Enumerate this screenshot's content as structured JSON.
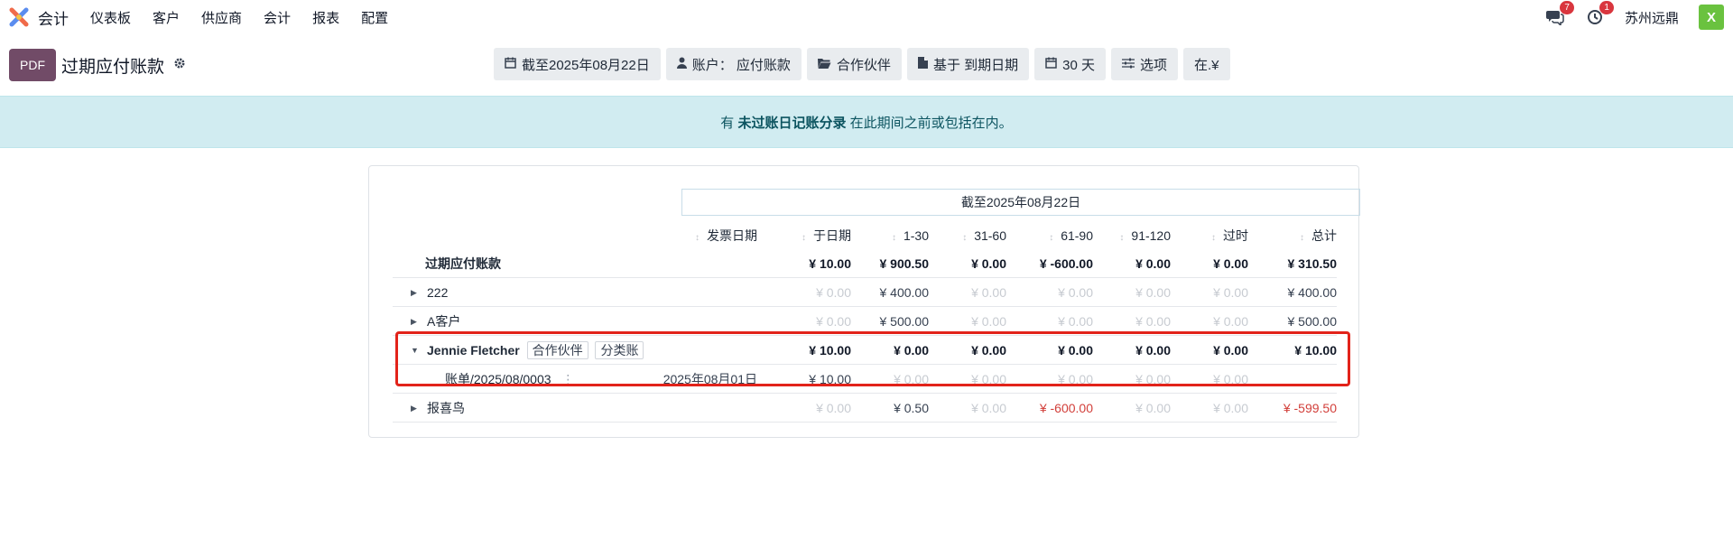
{
  "navbar": {
    "app_name": "会计",
    "menu": [
      "仪表板",
      "客户",
      "供应商",
      "会计",
      "报表",
      "配置"
    ],
    "chat_badge": "7",
    "activity_badge": "1",
    "company": "苏州远鼎",
    "avatar_letter": "X",
    "icons": [
      "app-logo-icon",
      "chat-icon",
      "clock-icon"
    ]
  },
  "control": {
    "pdf_label": "PDF",
    "title": "过期应付账款",
    "filters": [
      {
        "icon": "calendar-icon",
        "label": "截至2025年08月22日"
      },
      {
        "icon": "user-icon",
        "label": "账户： 应付账款"
      },
      {
        "icon": "folder-icon",
        "label": "合作伙伴"
      },
      {
        "icon": "file-icon",
        "label": "基于 到期日期"
      },
      {
        "icon": "calendar-icon",
        "label": "30 天"
      },
      {
        "icon": "sliders-icon",
        "label": "选项"
      },
      {
        "icon": "",
        "label": "在.¥"
      }
    ]
  },
  "alert": {
    "prefix": "有",
    "strong": "未过账日记账分录",
    "suffix": "在此期间之前或包括在内。"
  },
  "report": {
    "period": "截至2025年08月22日",
    "columns": [
      "发票日期",
      "于日期",
      "1-30",
      "31-60",
      "61-90",
      "91-120",
      "过时",
      "总计"
    ],
    "total_row": {
      "label": "过期应付账款",
      "values": [
        "",
        "¥ 10.00",
        "¥ 900.50",
        "¥ 0.00",
        "¥ -600.00",
        "¥ 0.00",
        "¥ 0.00",
        "¥ 310.50"
      ]
    },
    "rows": [
      {
        "label": "222",
        "values": [
          "",
          "¥ 0.00",
          "¥ 400.00",
          "¥ 0.00",
          "¥ 0.00",
          "¥ 0.00",
          "¥ 0.00",
          "¥ 400.00"
        ]
      },
      {
        "label": "A客户",
        "values": [
          "",
          "¥ 0.00",
          "¥ 500.00",
          "¥ 0.00",
          "¥ 0.00",
          "¥ 0.00",
          "¥ 0.00",
          "¥ 500.00"
        ]
      },
      {
        "label": "Jennie Fletcher",
        "tags": [
          "合作伙伴",
          "分类账"
        ],
        "values": [
          "",
          "¥ 10.00",
          "¥ 0.00",
          "¥ 0.00",
          "¥ 0.00",
          "¥ 0.00",
          "¥ 0.00",
          "¥ 10.00"
        ]
      },
      {
        "label": "账单/2025/08/0003",
        "values": [
          "2025年08月01日",
          "¥ 10.00",
          "¥ 0.00",
          "¥ 0.00",
          "¥ 0.00",
          "¥ 0.00",
          "¥ 0.00",
          ""
        ]
      },
      {
        "label": "报喜鸟",
        "values": [
          "",
          "¥ 0.00",
          "¥ 0.50",
          "¥ 0.00",
          "¥ -600.00",
          "¥ 0.00",
          "¥ 0.00",
          "¥ -599.50"
        ]
      }
    ]
  },
  "colors": {
    "brand": "#714b67",
    "alert_bg": "#d1ecf1",
    "negative": "#d23f3a",
    "highlight": "#e2231a"
  }
}
